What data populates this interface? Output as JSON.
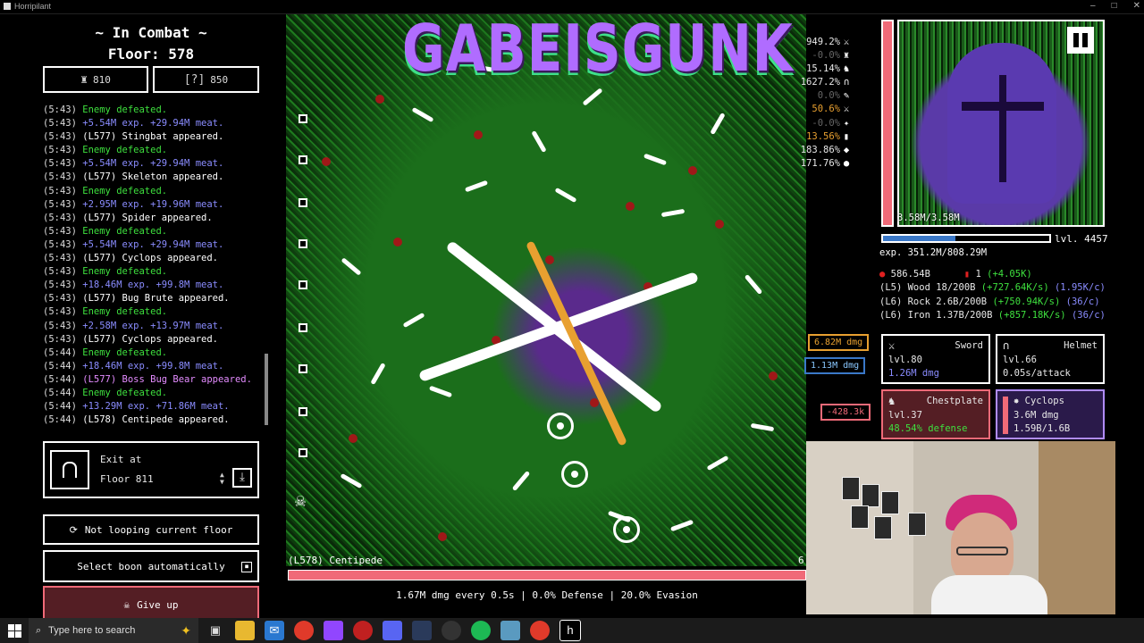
{
  "window": {
    "title": "Horripilant",
    "controls": [
      "–",
      "□",
      "✕"
    ]
  },
  "combat": {
    "status": "~ In Combat ~",
    "floor": "Floor: 578",
    "stat_left": "810",
    "stat_right": "850"
  },
  "log": [
    {
      "time": "(5:43)",
      "text": "Enemy defeated.",
      "color": "green"
    },
    {
      "time": "(5:43)",
      "text": "+5.54M exp. +29.94M meat.",
      "color": "blue"
    },
    {
      "time": "(5:43)",
      "text": "(L577) Stingbat appeared.",
      "color": "white"
    },
    {
      "time": "(5:43)",
      "text": "Enemy defeated.",
      "color": "green"
    },
    {
      "time": "(5:43)",
      "text": "+5.54M exp. +29.94M meat.",
      "color": "blue"
    },
    {
      "time": "(5:43)",
      "text": "(L577) Skeleton appeared.",
      "color": "white"
    },
    {
      "time": "(5:43)",
      "text": "Enemy defeated.",
      "color": "green"
    },
    {
      "time": "(5:43)",
      "text": "+2.95M exp. +19.96M meat.",
      "color": "blue"
    },
    {
      "time": "(5:43)",
      "text": "(L577) Spider appeared.",
      "color": "white"
    },
    {
      "time": "(5:43)",
      "text": "Enemy defeated.",
      "color": "green"
    },
    {
      "time": "(5:43)",
      "text": "+5.54M exp. +29.94M meat.",
      "color": "blue"
    },
    {
      "time": "(5:43)",
      "text": "(L577) Cyclops appeared.",
      "color": "white"
    },
    {
      "time": "(5:43)",
      "text": "Enemy defeated.",
      "color": "green"
    },
    {
      "time": "(5:43)",
      "text": "+18.46M exp. +99.8M meat.",
      "color": "blue"
    },
    {
      "time": "(5:43)",
      "text": "(L577) Bug Brute appeared.",
      "color": "white"
    },
    {
      "time": "(5:43)",
      "text": "Enemy defeated.",
      "color": "green"
    },
    {
      "time": "(5:43)",
      "text": "+2.58M exp. +13.97M meat.",
      "color": "blue"
    },
    {
      "time": "(5:43)",
      "text": "(L577) Cyclops appeared.",
      "color": "white"
    },
    {
      "time": "(5:44)",
      "text": "Enemy defeated.",
      "color": "green"
    },
    {
      "time": "(5:44)",
      "text": "+18.46M exp. +99.8M meat.",
      "color": "blue"
    },
    {
      "time": "(5:44)",
      "text": "(L577) Boss Bug Bear appeared.",
      "color": "purple"
    },
    {
      "time": "(5:44)",
      "text": "Enemy defeated.",
      "color": "green"
    },
    {
      "time": "(5:44)",
      "text": "+13.29M exp. +71.86M meat.",
      "color": "blue"
    },
    {
      "time": "(5:44)",
      "text": "(L578) Centipede appeared.",
      "color": "white"
    }
  ],
  "exit": {
    "label": "Exit at",
    "floor": "Floor 811"
  },
  "buttons": {
    "loop": "Not looping current floor",
    "boon": "Select boon automatically",
    "giveup": "Give up"
  },
  "game_logo": "GABEISGUNK",
  "multipliers": [
    {
      "value": "949.2%",
      "icon": "⚔",
      "dim": false
    },
    {
      "value": "-0.0%",
      "icon": "♜",
      "dim": true
    },
    {
      "value": "15.14%",
      "icon": "♞",
      "dim": false
    },
    {
      "value": "1627.2%",
      "icon": "∩",
      "dim": false
    },
    {
      "value": "0.0%",
      "icon": "✎",
      "dim": true
    },
    {
      "value": "50.6%",
      "icon": "⚔",
      "dim": false,
      "orange": true
    },
    {
      "value": "-0.0%",
      "icon": "✦",
      "dim": true
    },
    {
      "value": "13.56%",
      "icon": "▮",
      "dim": false,
      "orange": true
    },
    {
      "value": "183.86%",
      "icon": "◆",
      "dim": false
    },
    {
      "value": "171.76%",
      "icon": "●",
      "dim": false
    }
  ],
  "damage_popups": [
    "6.82M dmg",
    "1.13M dmg",
    "-428.3k"
  ],
  "enemy": {
    "name": "(L578) Centipede",
    "count": "6",
    "health_fraction": 1.0,
    "stats": "1.67M dmg every 0.5s | 0.0% Defense | 20.0% Evasion"
  },
  "player": {
    "hp_text": "3.58M/3.58M",
    "hp_fraction": 1.0,
    "level": "lvl. 4457",
    "exp_text": "exp. 351.2M/808.29M",
    "exp_fraction": 0.434
  },
  "resources": [
    {
      "parts": [
        [
          "red",
          "●"
        ],
        [
          "white",
          " 586.54B      "
        ],
        [
          "red",
          "▮"
        ],
        [
          "white",
          " 1 "
        ],
        [
          "green",
          "(+4.05K)"
        ]
      ]
    },
    {
      "parts": [
        [
          "white",
          "(L5) Wood 18/200B "
        ],
        [
          "green",
          "(+727.64K/s)"
        ],
        [
          "blue",
          " (1.95K/c)"
        ]
      ]
    },
    {
      "parts": [
        [
          "white",
          "(L6) Rock 2.6B/200B "
        ],
        [
          "green",
          "(+750.94K/s)"
        ],
        [
          "blue",
          " (36/c)"
        ]
      ]
    },
    {
      "parts": [
        [
          "white",
          "(L6) Iron 1.37B/200B "
        ],
        [
          "green",
          "(+857.18K/s)"
        ],
        [
          "blue",
          " (36/c)"
        ]
      ]
    }
  ],
  "equipment": {
    "sword": {
      "icon": "⚔",
      "name": "Sword",
      "level": "lvl.80",
      "stat": "1.26M dmg"
    },
    "helmet": {
      "icon": "∩",
      "name": "Helmet",
      "level": "lvl.66",
      "stat": "0.05s/attack"
    },
    "chestplate": {
      "icon": "♞",
      "name": "Chestplate",
      "level": "lvl.37",
      "stat": "48.54% defense"
    },
    "companion": {
      "icon": "✸",
      "name": "Cyclops",
      "level": "3.6M dmg",
      "stat": "1.59B/1.6B"
    }
  },
  "taskbar": {
    "search_placeholder": "Type here to search"
  },
  "colors": {
    "accent_red": "#f06a78",
    "log_green": "#3ee03e",
    "log_blue": "#8a8cff",
    "arena_green": "#1e7a1e"
  }
}
